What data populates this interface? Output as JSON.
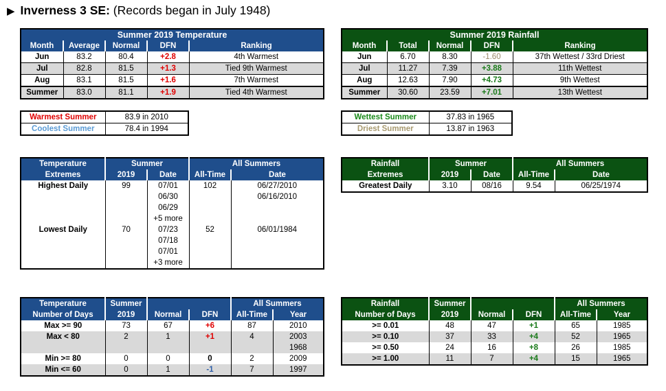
{
  "header": {
    "arrow_icon": "▶",
    "station": "Inverness 3 SE:",
    "note": "(Records began in July 1948)"
  },
  "temp_summary": {
    "title": "Summer 2019 Temperature",
    "columns": [
      "Month",
      "Average",
      "Normal",
      "DFN",
      "Ranking"
    ],
    "rows": [
      {
        "month": "Jun",
        "value": "83.2",
        "normal": "80.4",
        "dfn": "+2.8",
        "ranking": "4th Warmest"
      },
      {
        "month": "Jul",
        "value": "82.8",
        "normal": "81.5",
        "dfn": "+1.3",
        "ranking": "Tied 9th Warmest"
      },
      {
        "month": "Aug",
        "value": "83.1",
        "normal": "81.5",
        "dfn": "+1.6",
        "ranking": "7th Warmest"
      },
      {
        "month": "Summer",
        "value": "83.0",
        "normal": "81.1",
        "dfn": "+1.9",
        "ranking": "Tied 4th Warmest"
      }
    ]
  },
  "rain_summary": {
    "title": "Summer 2019 Rainfall",
    "columns": [
      "Month",
      "Total",
      "Normal",
      "DFN",
      "Ranking"
    ],
    "rows": [
      {
        "month": "Jun",
        "value": "6.70",
        "normal": "8.30",
        "dfn": "-1.60",
        "ranking": "37th Wettest / 33rd Driest"
      },
      {
        "month": "Jul",
        "value": "11.27",
        "normal": "7.39",
        "dfn": "+3.88",
        "ranking": "11th Wettest"
      },
      {
        "month": "Aug",
        "value": "12.63",
        "normal": "7.90",
        "dfn": "+4.73",
        "ranking": "9th Wettest"
      },
      {
        "month": "Summer",
        "value": "30.60",
        "normal": "23.59",
        "dfn": "+7.01",
        "ranking": "13th Wettest"
      }
    ]
  },
  "temp_records": {
    "warmest_label": "Warmest Summer",
    "warmest_value": "83.9 in 2010",
    "coolest_label": "Coolest Summer",
    "coolest_value": "78.4 in 1994"
  },
  "rain_records": {
    "wettest_label": "Wettest Summer",
    "wettest_value": "37.83 in 1965",
    "driest_label": "Driest Summer",
    "driest_value": "13.87 in 1963"
  },
  "temp_extremes": {
    "h1": "Temperature",
    "h2": "Extremes",
    "group_summer": "Summer",
    "group_all": "All Summers",
    "col_year": "2019",
    "col_date": "Date",
    "col_alltime": "All-Time",
    "col_alldate": "Date",
    "rows": [
      {
        "label": "Highest Daily",
        "value": "99",
        "dates": [
          "07/01",
          "06/30",
          "06/29",
          "+5 more"
        ],
        "alltime": "102",
        "alldates": [
          "06/27/2010",
          "06/16/2010"
        ]
      },
      {
        "label": "Lowest Daily",
        "value": "70",
        "dates": [
          "07/23",
          "07/18",
          "07/01",
          "+3 more"
        ],
        "alltime": "52",
        "alldates": [
          "06/01/1984"
        ]
      }
    ]
  },
  "rain_extremes": {
    "h1": "Rainfall",
    "h2": "Extremes",
    "group_summer": "Summer",
    "group_all": "All Summers",
    "col_year": "2019",
    "col_date": "Date",
    "col_alltime": "All-Time",
    "col_alldate": "Date",
    "rows": [
      {
        "label": "Greatest Daily",
        "value": "3.10",
        "date": "08/16",
        "alltime": "9.54",
        "alldate": "06/25/1974"
      }
    ]
  },
  "temp_days": {
    "h1": "Temperature",
    "h2": "Number of Days",
    "summer": "Summer",
    "year": "2019",
    "normal": "Normal",
    "dfn": "DFN",
    "group_all": "All Summers",
    "alltime": "All-Time",
    "col_year": "Year",
    "rows": [
      {
        "label": "Max >= 90",
        "value": "73",
        "normal": "67",
        "dfn": "+6",
        "alltime": "87",
        "years": [
          "2010"
        ]
      },
      {
        "label": "Max < 80",
        "value": "2",
        "normal": "1",
        "dfn": "+1",
        "alltime": "4",
        "years": [
          "2003",
          "1968"
        ]
      },
      {
        "label": "Min >= 80",
        "value": "0",
        "normal": "0",
        "dfn": "0",
        "alltime": "2",
        "years": [
          "2009"
        ]
      },
      {
        "label": "Min <= 60",
        "value": "0",
        "normal": "1",
        "dfn": "-1",
        "alltime": "7",
        "years": [
          "1997"
        ]
      }
    ]
  },
  "rain_days": {
    "h1": "Rainfall",
    "h2": "Number of Days",
    "summer": "Summer",
    "year": "2019",
    "normal": "Normal",
    "dfn": "DFN",
    "group_all": "All Summers",
    "alltime": "All-Time",
    "col_year": "Year",
    "rows": [
      {
        "label": ">= 0.01",
        "value": "48",
        "normal": "47",
        "dfn": "+1",
        "alltime": "65",
        "year": "1985"
      },
      {
        "label": ">= 0.10",
        "value": "37",
        "normal": "33",
        "dfn": "+4",
        "alltime": "52",
        "year": "1965"
      },
      {
        "label": ">= 0.50",
        "value": "24",
        "normal": "16",
        "dfn": "+8",
        "alltime": "26",
        "year": "1985"
      },
      {
        "label": ">= 1.00",
        "value": "11",
        "normal": "7",
        "dfn": "+4",
        "alltime": "15",
        "year": "1965"
      }
    ]
  },
  "colors": {
    "temp_header": "#1f4e8c",
    "rain_header": "#0b5212",
    "warm_red": "#e00000",
    "cool_blue": "#5b9bd5",
    "wet_green": "#1a7a1a",
    "dry_tan": "#9a8a6a",
    "alt_row": "#d9d9d9"
  }
}
